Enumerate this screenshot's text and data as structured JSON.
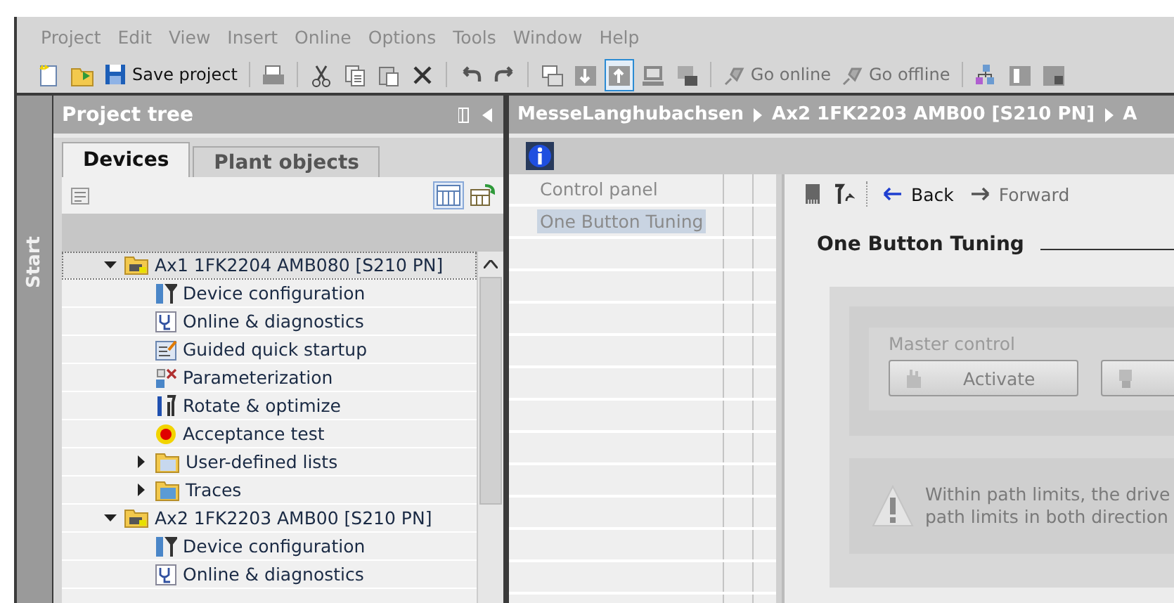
{
  "menu": [
    "Project",
    "Edit",
    "View",
    "Insert",
    "Online",
    "Options",
    "Tools",
    "Window",
    "Help"
  ],
  "toolbar": [
    {
      "kind": "icon",
      "selected": false
    },
    {
      "kind": "icon",
      "selected": false
    },
    {
      "kind": "button",
      "label": "Save project",
      "disabled": false
    },
    {
      "kind": "separator"
    },
    {
      "kind": "icon",
      "selected": false
    },
    {
      "kind": "separator"
    },
    {
      "kind": "icon",
      "selected": false
    },
    {
      "kind": "icon",
      "selected": false
    },
    {
      "kind": "icon",
      "selected": false
    },
    {
      "kind": "icon",
      "selected": false
    },
    {
      "kind": "separator"
    },
    {
      "kind": "icon",
      "selected": false
    },
    {
      "kind": "icon",
      "selected": false
    },
    {
      "kind": "separator"
    },
    {
      "kind": "icon",
      "selected": false
    },
    {
      "kind": "icon",
      "selected": false
    },
    {
      "kind": "icon",
      "selected": true
    },
    {
      "kind": "icon",
      "selected": false
    },
    {
      "kind": "icon",
      "selected": false
    },
    {
      "kind": "separator"
    },
    {
      "kind": "button",
      "label": "Go online",
      "disabled": true
    },
    {
      "kind": "button",
      "label": "Go offline",
      "disabled": true
    },
    {
      "kind": "separator"
    },
    {
      "kind": "icon",
      "selected": false
    },
    {
      "kind": "icon",
      "selected": false
    },
    {
      "kind": "icon",
      "selected": false
    }
  ],
  "start_tab": {
    "label": "Start"
  },
  "project_tree": {
    "title": "Project tree",
    "tabs": [
      {
        "label": "Devices",
        "selected": true
      },
      {
        "label": "Plant objects",
        "selected": false
      }
    ],
    "items": [
      {
        "kind": "device",
        "label": "Ax1 1FK2204 AMB080 [S210 PN]",
        "expanded": true,
        "selected": true,
        "children": [
          {
            "kind": "function",
            "label": "Device configuration"
          },
          {
            "kind": "function",
            "label": "Online & diagnostics"
          },
          {
            "kind": "function",
            "label": "Guided quick startup"
          },
          {
            "kind": "function",
            "label": "Parameterization"
          },
          {
            "kind": "function",
            "label": "Rotate & optimize"
          },
          {
            "kind": "function",
            "label": "Acceptance test"
          },
          {
            "kind": "folder",
            "label": "User-defined lists",
            "expanded": false
          },
          {
            "kind": "folder",
            "label": "Traces",
            "expanded": false
          }
        ]
      },
      {
        "kind": "device",
        "label": "Ax2 1FK2203 AMB00 [S210 PN]",
        "expanded": true,
        "selected": false,
        "children": [
          {
            "kind": "function",
            "label": "Device configuration"
          },
          {
            "kind": "function",
            "label": "Online & diagnostics"
          }
        ]
      }
    ]
  },
  "breadcrumb": [
    "MesseLanghubachsen",
    "Ax2 1FK2203 AMB00 [S210 PN]",
    "A"
  ],
  "navigation": [
    {
      "label": "Control panel",
      "selected": false
    },
    {
      "label": "One Button Tuning",
      "selected": true
    }
  ],
  "content": {
    "back": {
      "label": "Back",
      "disabled": false
    },
    "forward": {
      "label": "Forward",
      "disabled": true
    },
    "heading": "One Button Tuning",
    "group": {
      "title": "Master control",
      "buttons": [
        {
          "label": "Activate",
          "disabled": true
        },
        {
          "disabled": true
        }
      ]
    },
    "warning": [
      "Within path limits, the drive",
      "path limits in both direction"
    ]
  }
}
